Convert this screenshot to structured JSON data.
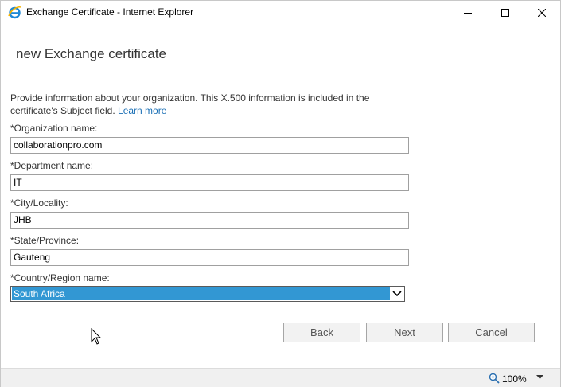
{
  "window": {
    "title": "Exchange Certificate - Internet Explorer",
    "icons": {
      "app": "internet-explorer-icon",
      "minimize": "minimize-icon",
      "maximize": "maximize-icon",
      "close": "close-icon"
    }
  },
  "page": {
    "title": "new Exchange certificate",
    "intro_text": "Provide information about your organization. This X.500 information is included in the certificate's Subject field.",
    "learn_more": "Learn more"
  },
  "form": {
    "organization": {
      "label": "*Organization name:",
      "value": "collaborationpro.com"
    },
    "department": {
      "label": "*Department name:",
      "value": "IT"
    },
    "city": {
      "label": "*City/Locality:",
      "value": "JHB"
    },
    "state": {
      "label": "*State/Province:",
      "value": "Gauteng"
    },
    "country": {
      "label": "*Country/Region name:",
      "selected": "South Africa"
    }
  },
  "buttons": {
    "back": "Back",
    "next": "Next",
    "cancel": "Cancel"
  },
  "statusbar": {
    "zoom": "100%",
    "zoom_icon": "zoom-icon"
  },
  "colors": {
    "selection": "#3297d3",
    "link": "#1a6fb5",
    "button_bg": "#f2f2f2"
  }
}
